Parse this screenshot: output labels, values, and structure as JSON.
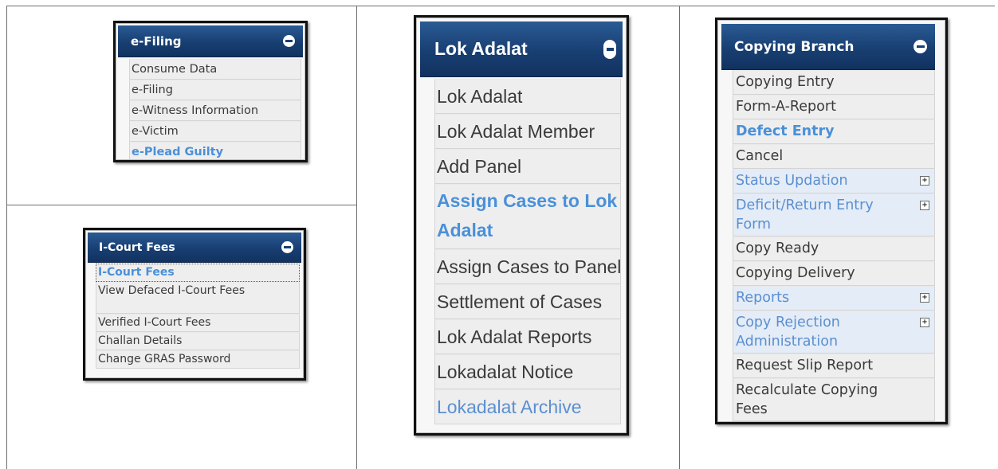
{
  "efiling": {
    "title": "e-Filing",
    "items": [
      "Consume Data",
      "e-Filing",
      "e-Witness Information",
      "e-Victim",
      "e-Plead Guilty"
    ]
  },
  "icourt": {
    "title": "I-Court Fees",
    "items": [
      "I-Court Fees",
      "View Defaced I-Court Fees",
      "Verified I-Court Fees",
      "Challan Details",
      "Change GRAS Password"
    ]
  },
  "lok_adalat": {
    "title": "Lok Adalat",
    "items": [
      "Lok Adalat",
      "Lok Adalat Member",
      "Add Panel",
      "Assign Cases to Lok Adalat",
      "Assign Cases to Panel",
      "Settlement of Cases",
      "Lok Adalat Reports",
      "Lokadalat Notice",
      "Lokadalat Archive"
    ]
  },
  "copying_branch": {
    "title": "Copying Branch",
    "items": [
      "Copying Entry",
      "Form-A-Report",
      "Defect Entry",
      "Cancel",
      "Status Updation",
      "Deficit/Return Entry Form",
      "Copy Ready",
      "Copying Delivery",
      "Reports",
      "Copy Rejection Administration",
      "Request Slip Report",
      "Recalculate Copying Fees"
    ],
    "expand_glyph": "+"
  },
  "colors": {
    "header_dark": "#183f72",
    "active_link": "#4a90d9",
    "expandable_text": "#5b8fd0",
    "item_bg": "#eeeeee",
    "border": "#111111"
  },
  "icons": {
    "collapse": "minus-circle-icon",
    "expand": "plus-box-icon"
  }
}
